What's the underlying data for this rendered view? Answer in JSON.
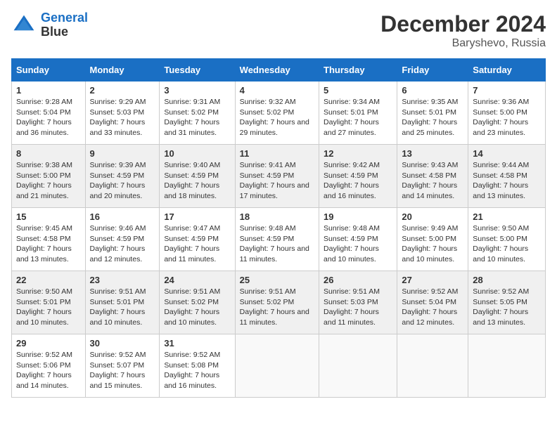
{
  "logo": {
    "line1": "General",
    "line2": "Blue"
  },
  "title": "December 2024",
  "location": "Baryshevo, Russia",
  "days_of_week": [
    "Sunday",
    "Monday",
    "Tuesday",
    "Wednesday",
    "Thursday",
    "Friday",
    "Saturday"
  ],
  "weeks": [
    [
      {
        "day": "1",
        "sunrise": "9:28 AM",
        "sunset": "5:04 PM",
        "daylight": "7 hours and 36 minutes."
      },
      {
        "day": "2",
        "sunrise": "9:29 AM",
        "sunset": "5:03 PM",
        "daylight": "7 hours and 33 minutes."
      },
      {
        "day": "3",
        "sunrise": "9:31 AM",
        "sunset": "5:02 PM",
        "daylight": "7 hours and 31 minutes."
      },
      {
        "day": "4",
        "sunrise": "9:32 AM",
        "sunset": "5:02 PM",
        "daylight": "7 hours and 29 minutes."
      },
      {
        "day": "5",
        "sunrise": "9:34 AM",
        "sunset": "5:01 PM",
        "daylight": "7 hours and 27 minutes."
      },
      {
        "day": "6",
        "sunrise": "9:35 AM",
        "sunset": "5:01 PM",
        "daylight": "7 hours and 25 minutes."
      },
      {
        "day": "7",
        "sunrise": "9:36 AM",
        "sunset": "5:00 PM",
        "daylight": "7 hours and 23 minutes."
      }
    ],
    [
      {
        "day": "8",
        "sunrise": "9:38 AM",
        "sunset": "5:00 PM",
        "daylight": "7 hours and 21 minutes."
      },
      {
        "day": "9",
        "sunrise": "9:39 AM",
        "sunset": "4:59 PM",
        "daylight": "7 hours and 20 minutes."
      },
      {
        "day": "10",
        "sunrise": "9:40 AM",
        "sunset": "4:59 PM",
        "daylight": "7 hours and 18 minutes."
      },
      {
        "day": "11",
        "sunrise": "9:41 AM",
        "sunset": "4:59 PM",
        "daylight": "7 hours and 17 minutes."
      },
      {
        "day": "12",
        "sunrise": "9:42 AM",
        "sunset": "4:59 PM",
        "daylight": "7 hours and 16 minutes."
      },
      {
        "day": "13",
        "sunrise": "9:43 AM",
        "sunset": "4:58 PM",
        "daylight": "7 hours and 14 minutes."
      },
      {
        "day": "14",
        "sunrise": "9:44 AM",
        "sunset": "4:58 PM",
        "daylight": "7 hours and 13 minutes."
      }
    ],
    [
      {
        "day": "15",
        "sunrise": "9:45 AM",
        "sunset": "4:58 PM",
        "daylight": "7 hours and 13 minutes."
      },
      {
        "day": "16",
        "sunrise": "9:46 AM",
        "sunset": "4:59 PM",
        "daylight": "7 hours and 12 minutes."
      },
      {
        "day": "17",
        "sunrise": "9:47 AM",
        "sunset": "4:59 PM",
        "daylight": "7 hours and 11 minutes."
      },
      {
        "day": "18",
        "sunrise": "9:48 AM",
        "sunset": "4:59 PM",
        "daylight": "7 hours and 11 minutes."
      },
      {
        "day": "19",
        "sunrise": "9:48 AM",
        "sunset": "4:59 PM",
        "daylight": "7 hours and 10 minutes."
      },
      {
        "day": "20",
        "sunrise": "9:49 AM",
        "sunset": "5:00 PM",
        "daylight": "7 hours and 10 minutes."
      },
      {
        "day": "21",
        "sunrise": "9:50 AM",
        "sunset": "5:00 PM",
        "daylight": "7 hours and 10 minutes."
      }
    ],
    [
      {
        "day": "22",
        "sunrise": "9:50 AM",
        "sunset": "5:01 PM",
        "daylight": "7 hours and 10 minutes."
      },
      {
        "day": "23",
        "sunrise": "9:51 AM",
        "sunset": "5:01 PM",
        "daylight": "7 hours and 10 minutes."
      },
      {
        "day": "24",
        "sunrise": "9:51 AM",
        "sunset": "5:02 PM",
        "daylight": "7 hours and 10 minutes."
      },
      {
        "day": "25",
        "sunrise": "9:51 AM",
        "sunset": "5:02 PM",
        "daylight": "7 hours and 11 minutes."
      },
      {
        "day": "26",
        "sunrise": "9:51 AM",
        "sunset": "5:03 PM",
        "daylight": "7 hours and 11 minutes."
      },
      {
        "day": "27",
        "sunrise": "9:52 AM",
        "sunset": "5:04 PM",
        "daylight": "7 hours and 12 minutes."
      },
      {
        "day": "28",
        "sunrise": "9:52 AM",
        "sunset": "5:05 PM",
        "daylight": "7 hours and 13 minutes."
      }
    ],
    [
      {
        "day": "29",
        "sunrise": "9:52 AM",
        "sunset": "5:06 PM",
        "daylight": "7 hours and 14 minutes."
      },
      {
        "day": "30",
        "sunrise": "9:52 AM",
        "sunset": "5:07 PM",
        "daylight": "7 hours and 15 minutes."
      },
      {
        "day": "31",
        "sunrise": "9:52 AM",
        "sunset": "5:08 PM",
        "daylight": "7 hours and 16 minutes."
      },
      null,
      null,
      null,
      null
    ]
  ]
}
